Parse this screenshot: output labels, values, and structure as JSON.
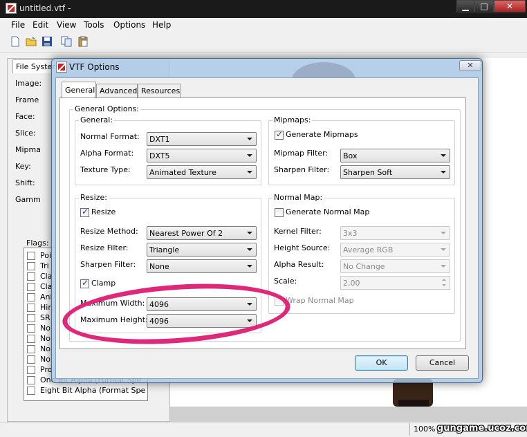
{
  "window": {
    "title": "untitled.vtf -"
  },
  "menu": [
    "File",
    "Edit",
    "View",
    "Tools",
    "Options",
    "Help"
  ],
  "left_panel": {
    "tab": "File Syster",
    "props": [
      "Image:",
      "Frame",
      "Face:",
      "Slice:",
      "Mipma",
      "Key:",
      "Shift:",
      "Gamm"
    ],
    "flags_label": "Flags:",
    "flags": [
      "Poi",
      "Tri",
      "Cla",
      "Cla",
      "Ani",
      "Hin",
      "SR",
      "No",
      "No",
      "No",
      "No",
      "Pro",
      "One Bit Alpha (Format Spe",
      "Eight Bit Alpha (Format Spe"
    ]
  },
  "status": {
    "zoom": "100%",
    "watermark": "gungame.ucoz.com"
  },
  "dialog": {
    "title": "VTF Options",
    "tabs": [
      "General",
      "Advanced",
      "Resources"
    ],
    "options_label": "General Options:",
    "general": {
      "label": "General:",
      "normal_format_label": "Normal Format:",
      "normal_format": "DXT1",
      "alpha_format_label": "Alpha Format:",
      "alpha_format": "DXT5",
      "texture_type_label": "Texture Type:",
      "texture_type": "Animated Texture"
    },
    "mipmaps": {
      "label": "Mipmaps:",
      "generate_label": "Generate Mipmaps",
      "filter_label": "Mipmap Filter:",
      "filter": "Box",
      "sharpen_label": "Sharpen Filter:",
      "sharpen": "Sharpen Soft"
    },
    "resize": {
      "label": "Resize:",
      "resize_label": "Resize",
      "method_label": "Resize Method:",
      "method": "Nearest Power Of 2",
      "filter_label": "Resize Filter:",
      "filter": "Triangle",
      "sharpen_label": "Sharpen Filter:",
      "sharpen": "None",
      "clamp_label": "Clamp",
      "max_width_label": "Maximum Width:",
      "max_width": "4096",
      "max_height_label": "Maximum Height:",
      "max_height": "4096"
    },
    "normal_map": {
      "label": "Normal Map:",
      "generate_label": "Generate Normal Map",
      "kernel_label": "Kernel Filter:",
      "kernel": "3x3",
      "height_label": "Height Source:",
      "height": "Average RGB",
      "alpha_label": "Alpha Result:",
      "alpha": "No Change",
      "scale_label": "Scale:",
      "scale": "2,00",
      "wrap_label": "Wrap Normal Map"
    },
    "ok": "OK",
    "cancel": "Cancel"
  }
}
